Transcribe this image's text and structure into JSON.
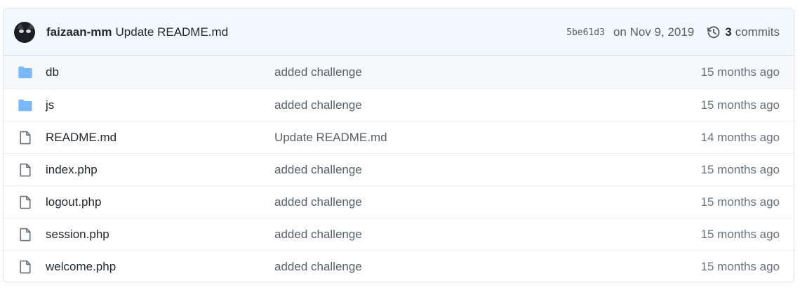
{
  "commit": {
    "author": "faizaan-mm",
    "message": "Update README.md",
    "sha": "5be61d3",
    "date": "on Nov 9, 2019",
    "commit_count": "3",
    "commits_label": "commits"
  },
  "colors": {
    "folder": "#79b8ff",
    "file_icon": "#6a737d",
    "header_bg": "#f1f8ff"
  },
  "files": [
    {
      "name": "db",
      "type": "folder",
      "message": "added challenge",
      "age": "15 months ago"
    },
    {
      "name": "js",
      "type": "folder",
      "message": "added challenge",
      "age": "15 months ago"
    },
    {
      "name": "README.md",
      "type": "file",
      "message": "Update README.md",
      "age": "14 months ago"
    },
    {
      "name": "index.php",
      "type": "file",
      "message": "added challenge",
      "age": "15 months ago"
    },
    {
      "name": "logout.php",
      "type": "file",
      "message": "added challenge",
      "age": "15 months ago"
    },
    {
      "name": "session.php",
      "type": "file",
      "message": "added challenge",
      "age": "15 months ago"
    },
    {
      "name": "welcome.php",
      "type": "file",
      "message": "added challenge",
      "age": "15 months ago"
    }
  ]
}
